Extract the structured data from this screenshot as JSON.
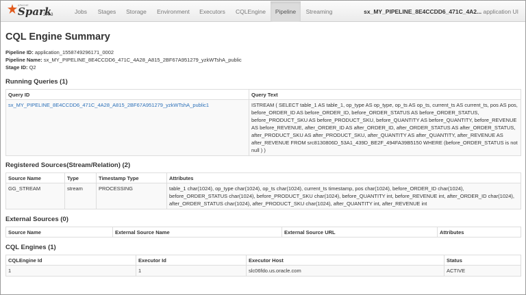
{
  "app": {
    "logo_small": "APACHE",
    "logo_text": "Spark",
    "version": "2.4.3",
    "nav_tabs": [
      "Jobs",
      "Stages",
      "Storage",
      "Environment",
      "Executors",
      "CQLEngine",
      "Pipeline",
      "Streaming"
    ],
    "active_tab": "Pipeline",
    "app_name": "sx_MY_PIPELINE_8E4CCDD6_471C_4A2...",
    "app_suffix": " application UI"
  },
  "page": {
    "title": "CQL Engine Summary",
    "pipeline_id_label": "Pipeline ID:",
    "pipeline_id": " application_1558749296171_0002",
    "pipeline_name_label": "Pipeline Name:",
    "pipeline_name": " sx_MY_PIPELINE_8E4CCDD6_471C_4A28_A815_2BF67A951279_yzkWTshA_public",
    "stage_id_label": "Stage ID:",
    "stage_id": " Q2"
  },
  "running_queries": {
    "heading": "Running Queries (1)",
    "columns": [
      "Query ID",
      "Query Text"
    ],
    "rows": [
      {
        "query_id": "sx_MY_PIPELINE_8E4CCDD6_471C_4A28_A815_2BF67A951279_yzkWTshA_public1",
        "query_text": "ISTREAM ( SELECT table_1 AS table_1, op_type AS op_type, op_ts AS op_ts, current_ts AS current_ts, pos AS pos, before_ORDER_ID AS before_ORDER_ID, before_ORDER_STATUS AS before_ORDER_STATUS, before_PRODUCT_SKU AS before_PRODUCT_SKU, before_QUANTITY AS before_QUANTITY, before_REVENUE AS before_REVENUE, after_ORDER_ID AS after_ORDER_ID, after_ORDER_STATUS AS after_ORDER_STATUS, after_PRODUCT_SKU AS after_PRODUCT_SKU, after_QUANTITY AS after_QUANTITY, after_REVENUE AS after_REVENUE FROM src8130806D_53A1_439D_BE2F_494FA39B5150 WHERE (before_ORDER_STATUS is not null ) )"
      }
    ]
  },
  "registered_sources": {
    "heading": "Registered Sources(Stream/Relation) (2)",
    "columns": [
      "Source Name",
      "Type",
      "Timestamp Type",
      "Attributes"
    ],
    "rows": [
      {
        "name": "GG_STREAM",
        "type": "stream",
        "timestamp_type": "PROCESSING",
        "attributes": "table_1 char(1024), op_type char(1024), op_ts char(1024), current_ts timestamp, pos char(1024), before_ORDER_ID char(1024), before_ORDER_STATUS char(1024), before_PRODUCT_SKU char(1024), before_QUANTITY int, before_REVENUE int, after_ORDER_ID char(1024), after_ORDER_STATUS char(1024), after_PRODUCT_SKU char(1024), after_QUANTITY int, after_REVENUE int"
      }
    ]
  },
  "external_sources": {
    "heading": "External Sources (0)",
    "columns": [
      "Source Name",
      "External Source Name",
      "External Source URL",
      "Attributes"
    ]
  },
  "cql_engines": {
    "heading": "CQL Engines (1)",
    "columns": [
      "CQLEngine Id",
      "Executor Id",
      "Executor Host",
      "Status"
    ],
    "rows": [
      {
        "engine_id": "1",
        "executor_id": "1",
        "executor_host": "slc06fdo.us.oracle.com",
        "status": "ACTIVE"
      }
    ]
  },
  "colors": {
    "link": "#2a6fb8",
    "spark_flame": "#e25a1c",
    "active_tab_bg": "#dcdcdc"
  }
}
